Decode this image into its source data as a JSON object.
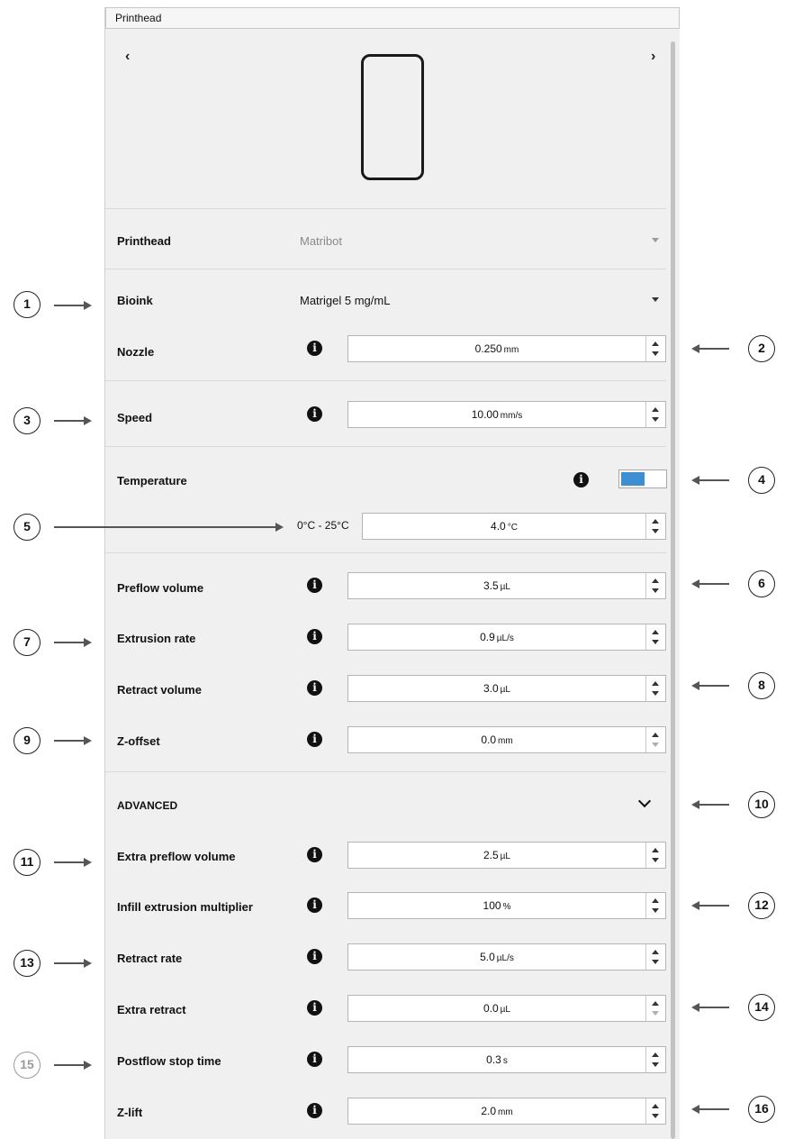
{
  "panel": {
    "title": "Printhead"
  },
  "carousel": {
    "prev_icon": "chevron-left-icon",
    "next_icon": "chevron-right-icon",
    "prev": "‹",
    "next": "›"
  },
  "printhead": {
    "label": "Printhead",
    "value": "Matribot"
  },
  "bioink": {
    "label": "Bioink",
    "value": "Matrigel 5 mg/mL"
  },
  "nozzle": {
    "label": "Nozzle",
    "value": "0.250",
    "unit": "mm"
  },
  "speed": {
    "label": "Speed",
    "value": "10.00",
    "unit": "mm/s"
  },
  "temperature": {
    "label": "Temperature",
    "enabled": true,
    "range": "0°C - 25°C",
    "value": "4.0",
    "unit": "°C",
    "accent": "#3d8fd1"
  },
  "extrusion": {
    "preflow_volume": {
      "label": "Preflow volume",
      "value": "3.5",
      "unit": "µL"
    },
    "extrusion_rate": {
      "label": "Extrusion rate",
      "value": "0.9",
      "unit": "µL/s"
    },
    "retract_volume": {
      "label": "Retract volume",
      "value": "3.0",
      "unit": "µL"
    },
    "z_offset": {
      "label": "Z-offset",
      "value": "0.0",
      "unit": "mm"
    }
  },
  "advanced": {
    "title": "ADVANCED",
    "extra_preflow_volume": {
      "label": "Extra preflow volume",
      "value": "2.5",
      "unit": "µL"
    },
    "infill_extrusion_multiplier": {
      "label": "Infill extrusion multiplier",
      "value": "100",
      "unit": "%"
    },
    "retract_rate": {
      "label": "Retract rate",
      "value": "5.0",
      "unit": "µL/s"
    },
    "extra_retract": {
      "label": "Extra retract",
      "value": "0.0",
      "unit": "µL"
    },
    "postflow_stop_time": {
      "label": "Postflow stop time",
      "value": "0.3",
      "unit": "s"
    },
    "z_lift": {
      "label": "Z-lift",
      "value": "2.0",
      "unit": "mm"
    }
  },
  "callouts": [
    "1",
    "2",
    "3",
    "4",
    "5",
    "6",
    "7",
    "8",
    "9",
    "10",
    "11",
    "12",
    "13",
    "14",
    "15",
    "16"
  ],
  "info_icon_glyph": "i"
}
